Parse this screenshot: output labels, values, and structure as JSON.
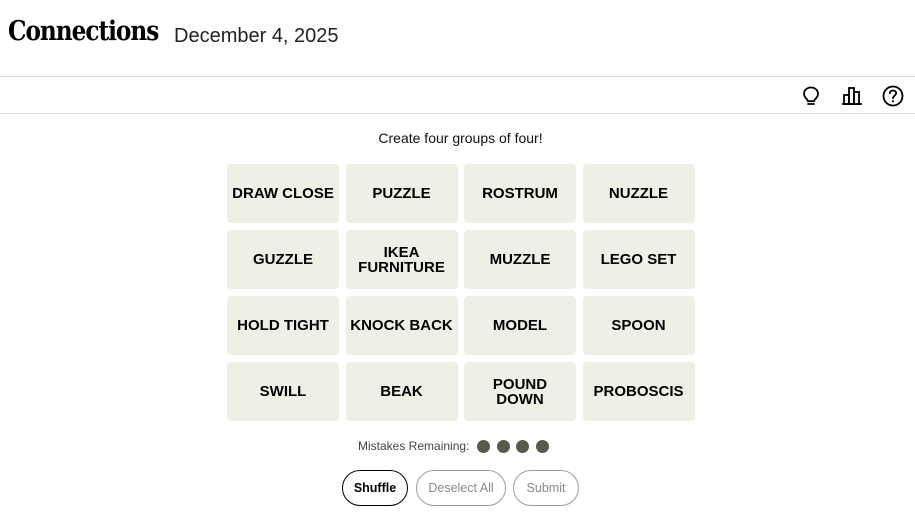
{
  "header": {
    "title": "Connections",
    "date": "December 4, 2025"
  },
  "toolbar": {
    "icons": [
      "lightbulb-icon",
      "bar-chart-icon",
      "help-icon"
    ]
  },
  "instructions": "Create four groups of four!",
  "board": {
    "tiles": [
      [
        "DRAW CLOSE",
        "PUZZLE",
        "ROSTRUM",
        "NUZZLE"
      ],
      [
        "GUZZLE",
        "IKEA FURNITURE",
        "MUZZLE",
        "LEGO SET"
      ],
      [
        "HOLD TIGHT",
        "KNOCK BACK",
        "MODEL",
        "SPOON"
      ],
      [
        "SWILL",
        "BEAK",
        "POUND DOWN",
        "PROBOSCIS"
      ]
    ]
  },
  "mistakes": {
    "label": "Mistakes Remaining:",
    "remaining": 4,
    "dot_color": "#5a594e"
  },
  "controls": {
    "shuffle_label": "Shuffle",
    "deselect_label": "Deselect All",
    "submit_label": "Submit"
  }
}
